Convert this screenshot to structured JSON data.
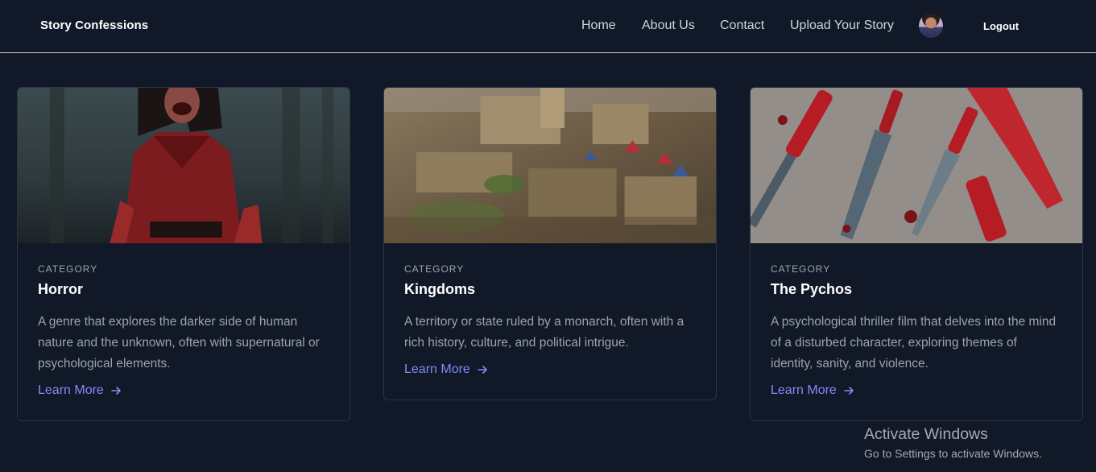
{
  "navbar": {
    "brand": "Story Confessions",
    "links": [
      "Home",
      "About Us",
      "Contact",
      "Upload Your Story"
    ],
    "logout": "Logout"
  },
  "cards": [
    {
      "category_label": "CATEGORY",
      "title": "Horror",
      "description": "A genre that explores the darker side of human nature and the unknown, often with supernatural or psychological elements.",
      "link": "Learn More"
    },
    {
      "category_label": "CATEGORY",
      "title": "Kingdoms",
      "description": "A territory or state ruled by a monarch, often with a rich history, culture, and political intrigue.",
      "link": "Learn More"
    },
    {
      "category_label": "CATEGORY",
      "title": "The Pychos",
      "description": "A psychological thriller film that delves into the mind of a disturbed character, exploring themes of identity, sanity, and violence.",
      "link": "Learn More"
    }
  ],
  "watermark": {
    "title": "Activate Windows",
    "subtitle": "Go to Settings to activate Windows."
  }
}
